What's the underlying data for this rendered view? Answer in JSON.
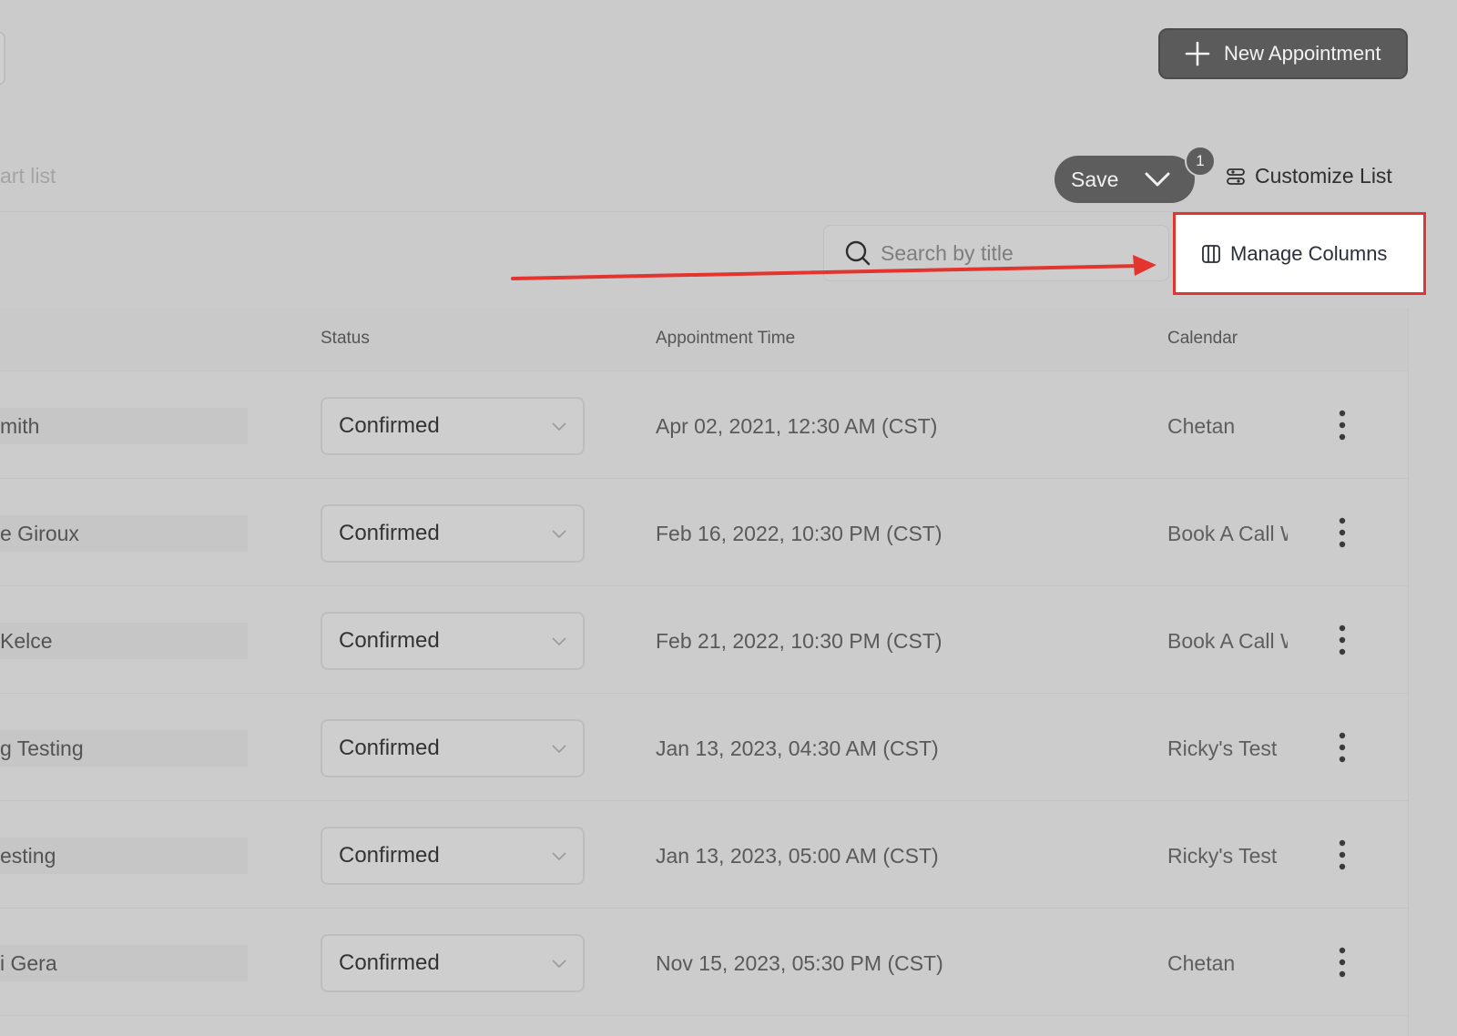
{
  "header": {
    "new_appointment_label": "New Appointment",
    "smart_list_fragment": "art list"
  },
  "toolbar": {
    "save_label": "Save",
    "save_badge": "1",
    "customize_label": "Customize List",
    "search_placeholder": "Search by title",
    "manage_columns_label": "Manage Columns"
  },
  "table": {
    "columns": [
      "Status",
      "Appointment Time",
      "Calendar"
    ],
    "rows": [
      {
        "name": "mith",
        "status": "Confirmed",
        "time": "Apr 02, 2021, 12:30 AM (CST)",
        "calendar": "Chetan"
      },
      {
        "name": "e Giroux",
        "status": "Confirmed",
        "time": "Feb 16, 2022, 10:30 PM (CST)",
        "calendar": "Book A Call With"
      },
      {
        "name": " Kelce",
        "status": "Confirmed",
        "time": "Feb 21, 2022, 10:30 PM (CST)",
        "calendar": "Book A Call With"
      },
      {
        "name": "g Testing",
        "status": "Confirmed",
        "time": "Jan 13, 2023, 04:30 AM (CST)",
        "calendar": "Ricky's Test"
      },
      {
        "name": "esting",
        "status": "Confirmed",
        "time": "Jan 13, 2023, 05:00 AM (CST)",
        "calendar": "Ricky's Test"
      },
      {
        "name": "i Gera",
        "status": "Confirmed",
        "time": "Nov 15, 2023, 05:30 PM (CST)",
        "calendar": "Chetan"
      }
    ]
  },
  "colors": {
    "highlight_border": "#e3342f",
    "arrow": "#e3342f",
    "primary_button": "#5b5b5b"
  },
  "icons": {
    "new_appointment": "plus-icon",
    "save_dropdown": "chevron-down-icon",
    "customize": "sliders-icon",
    "search": "search-icon",
    "manage_columns": "columns-icon",
    "row_menu": "kebab-icon"
  }
}
